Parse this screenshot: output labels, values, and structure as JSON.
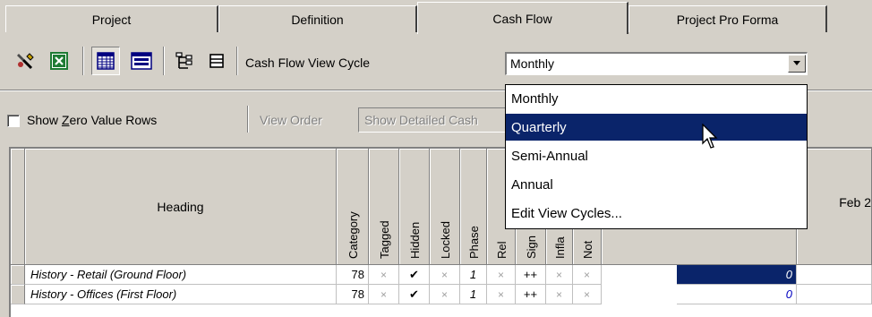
{
  "tabs": [
    {
      "label": "Project"
    },
    {
      "label": "Definition"
    },
    {
      "label": "Cash Flow"
    },
    {
      "label": "Project Pro Forma"
    }
  ],
  "active_tab": "Cash Flow",
  "toolbar": {
    "view_cycle_label": "Cash Flow View Cycle",
    "view_cycle_value": "Monthly",
    "icons": [
      "wand-icon",
      "excel-icon",
      "grid-view-icon",
      "grid-detail-icon",
      "tree-collapse-icon",
      "tree-expand-icon"
    ]
  },
  "dropdown": {
    "items": [
      "Monthly",
      "Quarterly",
      "Semi-Annual",
      "Annual",
      "Edit View Cycles..."
    ],
    "highlighted": "Quarterly"
  },
  "options": {
    "show_zero_label": "Show Zero Value Rows",
    "show_zero_mnemonic_prefix": "Show ",
    "show_zero_mnemonic_char": "Z",
    "show_zero_mnemonic_suffix": "ero Value Rows",
    "view_order_label": "View Order",
    "detailed_cash_label": "Show Detailed Cash",
    "show_zero_checked": false
  },
  "grid": {
    "heading_label": "Heading",
    "columns": [
      "Category",
      "Tagged",
      "Hidden",
      "Locked",
      "Phase",
      "Rel",
      "Sign",
      "Infla",
      "Not"
    ],
    "date_header": "Feb 2",
    "rows": [
      {
        "heading": "History - Retail (Ground Floor)",
        "category": "78",
        "tagged": "×",
        "hidden": "✔",
        "locked": "×",
        "phase": "1",
        "rel": "×",
        "sign": "++",
        "infla": "×",
        "not": "×",
        "value": "0",
        "selected": true
      },
      {
        "heading": "History - Offices (First Floor)",
        "category": "78",
        "tagged": "×",
        "hidden": "✔",
        "locked": "×",
        "phase": "1",
        "rel": "×",
        "sign": "++",
        "infla": "×",
        "not": "×",
        "value": "0",
        "selected": false
      }
    ]
  },
  "colors": {
    "window_bg": "#d4d0c8",
    "selection": "#0a246a",
    "excel_green": "#1e7b34"
  }
}
